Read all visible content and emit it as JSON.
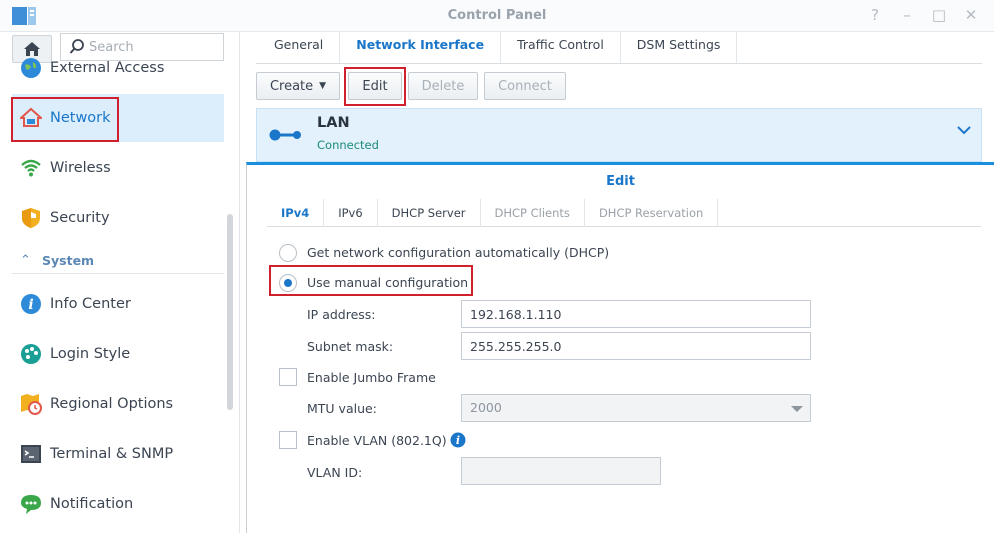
{
  "window": {
    "title": "Control Panel",
    "controls": [
      "?",
      "–",
      "□",
      "✕"
    ]
  },
  "sidebar": {
    "search_placeholder": "Search",
    "items": [
      {
        "label": "External Access",
        "icon": "globe-icon"
      },
      {
        "label": "Network",
        "icon": "house-network-icon",
        "active": true
      },
      {
        "label": "Wireless",
        "icon": "wifi-icon"
      },
      {
        "label": "Security",
        "icon": "shield-icon"
      },
      {
        "label": "Info Center",
        "icon": "info-icon"
      },
      {
        "label": "Login Style",
        "icon": "palette-icon"
      },
      {
        "label": "Regional Options",
        "icon": "clock-map-icon"
      },
      {
        "label": "Terminal & SNMP",
        "icon": "terminal-icon"
      },
      {
        "label": "Notification",
        "icon": "chat-bubble-icon"
      }
    ],
    "section": {
      "label": "System",
      "icon": "chevron-up-icon"
    }
  },
  "tabs": [
    {
      "label": "General"
    },
    {
      "label": "Network Interface",
      "active": true
    },
    {
      "label": "Traffic Control"
    },
    {
      "label": "DSM Settings"
    }
  ],
  "toolbar": {
    "create": "Create",
    "edit": "Edit",
    "delete": "Delete",
    "connect": "Connect"
  },
  "lan": {
    "name": "LAN",
    "status": "Connected"
  },
  "dialog": {
    "title": "Edit",
    "tabs": [
      "IPv4",
      "IPv6",
      "DHCP Server",
      "DHCP Clients",
      "DHCP Reservation"
    ],
    "dhcp_option": "Get network configuration automatically (DHCP)",
    "manual_option": "Use manual configuration",
    "ip_label": "IP address:",
    "ip_value": "192.168.1.110",
    "subnet_label": "Subnet mask:",
    "subnet_value": "255.255.255.0",
    "jumbo_label": "Enable Jumbo Frame",
    "mtu_label": "MTU value:",
    "mtu_value": "2000",
    "vlan_label": "Enable VLAN (802.1Q)",
    "vlan_id_label": "VLAN ID:",
    "vlan_id_value": ""
  },
  "colors": {
    "accent": "#1a76c9",
    "highlight": "#d0202e",
    "active_bg": "#dceefb"
  }
}
